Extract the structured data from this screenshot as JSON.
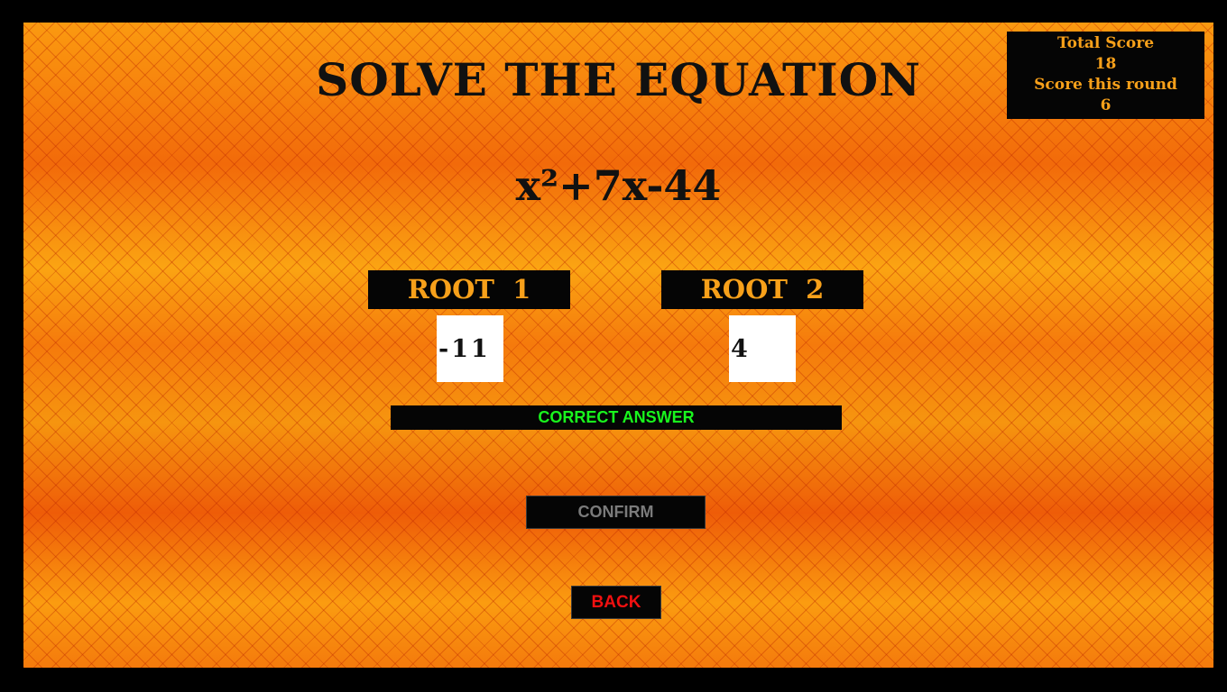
{
  "title": "SOLVE THE EQUATION",
  "score_panel": {
    "total_label": "Total Score",
    "total_value": "18",
    "round_label": "Score this round",
    "round_value": "6"
  },
  "equation": "x²+7x-44",
  "roots": [
    {
      "label": "ROOT  1",
      "value": "-11"
    },
    {
      "label": "ROOT  2",
      "value": "4"
    }
  ],
  "status": {
    "text": "CORRECT ANSWER",
    "color": "#19f51d"
  },
  "confirm_label": "CONFIRM",
  "back_label": "BACK",
  "colors": {
    "background_orange": "#f57a0c",
    "panel_black": "#050505",
    "label_orange": "#f7a01a",
    "back_red": "#f01010",
    "confirm_gray": "#7b7b7b"
  }
}
